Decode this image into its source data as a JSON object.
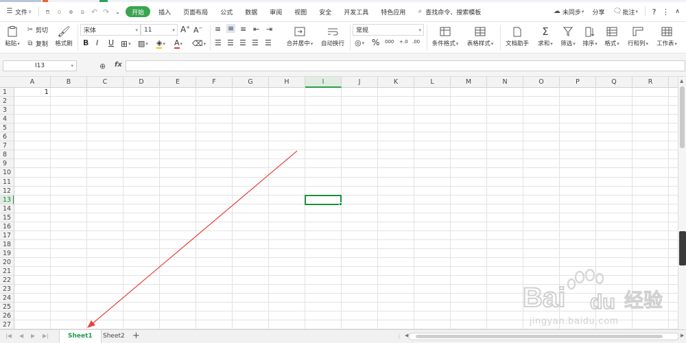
{
  "menubar": {
    "file_label": "文件",
    "tabs": [
      "开始",
      "插入",
      "页面布局",
      "公式",
      "数据",
      "审阅",
      "视图",
      "安全",
      "开发工具",
      "特色应用"
    ],
    "search_label": "查找命令、搜索模板",
    "sync_label": "未同步",
    "share_label": "分享",
    "comment_label": "批注"
  },
  "ribbon": {
    "paste_label": "粘贴",
    "cut_label": "剪切",
    "copy_label": "复制",
    "format_painter_label": "格式刷",
    "font_name": "宋体",
    "font_size": "11",
    "merge_label": "合并居中",
    "wrap_label": "自动换行",
    "number_format": "常规",
    "conditional_label": "条件格式",
    "table_style_label": "表格样式",
    "doc_helper_label": "文档助手",
    "sum_label": "求和",
    "filter_label": "筛选",
    "sort_label": "排序",
    "format_label": "格式",
    "rowcol_label": "行和列",
    "worksheet_label": "工作表"
  },
  "formula_bar": {
    "name_box": "I13",
    "fx_label": "fx",
    "formula_value": ""
  },
  "grid": {
    "columns": [
      "A",
      "B",
      "C",
      "D",
      "E",
      "F",
      "G",
      "H",
      "I",
      "J",
      "K",
      "L",
      "M",
      "N",
      "O",
      "P",
      "Q",
      "R"
    ],
    "rows": [
      "1",
      "2",
      "3",
      "4",
      "5",
      "6",
      "7",
      "8",
      "9",
      "10",
      "11",
      "12",
      "13",
      "14",
      "15",
      "16",
      "17",
      "18",
      "19",
      "20",
      "21",
      "22",
      "23",
      "24",
      "25",
      "26",
      "27"
    ],
    "active_cell": "I13",
    "active_column": "I",
    "active_row": "13",
    "cell_A1": "1"
  },
  "sheets": {
    "tabs": [
      "Sheet1",
      "Sheet2"
    ],
    "active": "Sheet1",
    "add_label": "+"
  },
  "watermark": {
    "brand": "Bai",
    "brand_tail": "du",
    "brand_cn": "经验",
    "url": "jingyan.baidu.com"
  },
  "colors": {
    "accent_green": "#3aa44e",
    "annotation_red": "#e8413a"
  }
}
